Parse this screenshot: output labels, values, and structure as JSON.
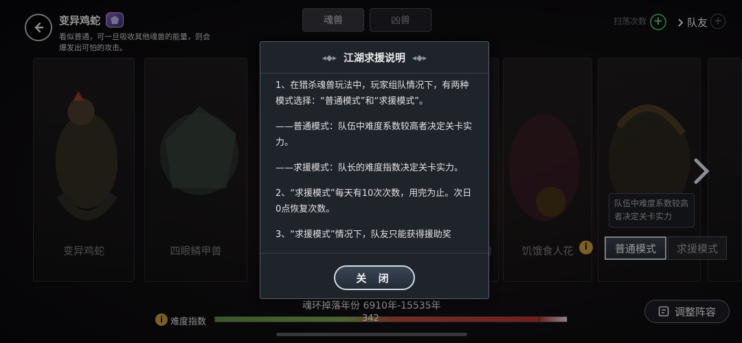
{
  "header": {
    "title": "变异鸡蛇",
    "description": "看似普通，可一旦吸收其他魂兽的能量，则会爆发出可怕的攻击。"
  },
  "top_tabs": [
    {
      "label": "魂兽",
      "active": true
    },
    {
      "label": "凶兽",
      "active": false
    }
  ],
  "top_right": {
    "sweep_label": "扫荡次数",
    "teammate_label": "队友"
  },
  "cards": [
    {
      "name": "变异鸡蛇"
    },
    {
      "name": "四眼鳞甲兽"
    },
    {
      "name": "兽"
    },
    {
      "name": "饥饿食人花"
    }
  ],
  "mode_panel": {
    "tooltip": "队伍中难度系数较高者决定关卡实力",
    "normal_label": "普通模式",
    "rescue_label": "求援模式",
    "selected": "普通模式"
  },
  "bottom": {
    "drop_years": "魂环掉落年份 6910年-15535年",
    "difficulty_label": "难度指数",
    "difficulty_value": "342",
    "difficulty_fill_fraction": 0.42,
    "adjust_label": "调整阵容"
  },
  "dialog": {
    "title": "江湖求援说明",
    "paragraphs": [
      "1、在猎杀魂兽玩法中，玩家组队情况下，有两种模式选择：“普通模式”和“求援模式”。",
      "——普通模式：队伍中难度系数较高者决定关卡实力。",
      "——求援模式：队长的难度指数决定关卡实力。",
      "2、“求援模式”每天有10次次数，用完为止。次日0点恢复次数。",
      "3、“求援模式”情况下，队友只能获得援助奖"
    ],
    "close_label": "关 闭"
  },
  "icons": {
    "back": "back-arrow-icon",
    "element": "element-badge-icon",
    "info": "info-icon",
    "next": "chevron-right-icon",
    "adjust": "lineup-icon"
  }
}
